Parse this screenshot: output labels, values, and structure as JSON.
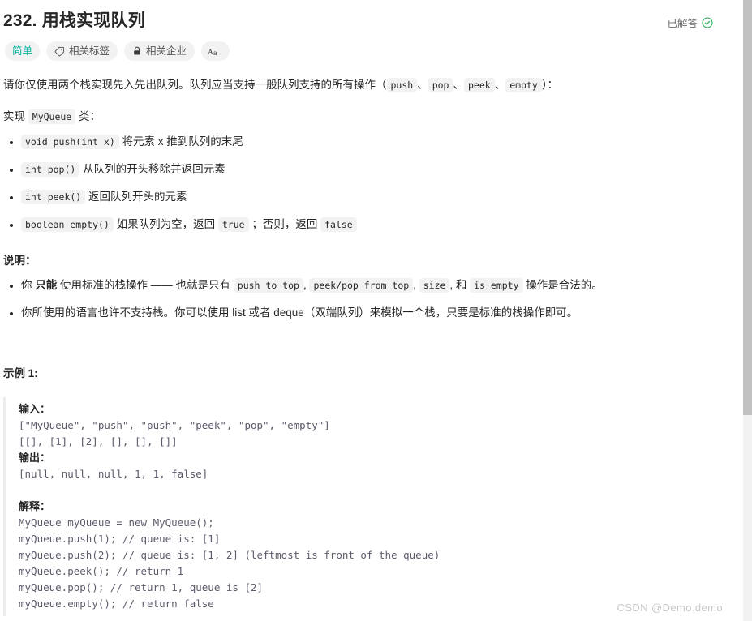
{
  "problem": {
    "title": "232. 用栈实现队列",
    "status_label": "已解答",
    "status_icon": "check-circle-icon",
    "status_color": "#2db55d"
  },
  "tags": {
    "difficulty": {
      "label": "简单",
      "color": "#00af9b"
    },
    "topics": {
      "label": "相关标签",
      "icon": "tag-icon"
    },
    "companies": {
      "label": "相关企业",
      "icon": "lock-icon"
    },
    "font_toggle": {
      "label": "Aa",
      "icon": "font-size-icon"
    }
  },
  "description": {
    "intro_1": "请你仅使用两个栈实现先入先出队列。队列应当支持一般队列支持的所有操作（",
    "intro_code_1": "push",
    "sep_1": "、",
    "intro_code_2": "pop",
    "sep_2": "、",
    "intro_code_3": "peek",
    "sep_3": "、",
    "intro_code_4": "empty",
    "intro_2": "）：",
    "implement_prefix": "实现 ",
    "implement_code": "MyQueue",
    "implement_suffix": " 类：",
    "methods": [
      {
        "code": "void push(int x)",
        "text": " 将元素 x 推到队列的末尾"
      },
      {
        "code": "int pop()",
        "text": " 从队列的开头移除并返回元素"
      },
      {
        "code": "int peek()",
        "text": " 返回队列开头的元素"
      }
    ],
    "method_empty": {
      "code": "boolean empty()",
      "text_1": " 如果队列为空，返回 ",
      "code_true": "true",
      "text_2": " ；否则，返回 ",
      "code_false": "false"
    }
  },
  "notes": {
    "heading": "说明：",
    "item1": {
      "t1": "你 ",
      "bold": "只能",
      "t2": " 使用标准的栈操作 —— 也就是只有 ",
      "c1": "push to top",
      "t3": ", ",
      "c2": "peek/pop from top",
      "t4": ", ",
      "c3": "size",
      "t5": ", 和 ",
      "c4": "is empty",
      "t6": " 操作是合法的。"
    },
    "item2": "你所使用的语言也许不支持栈。你可以使用 list 或者 deque（双端队列）来模拟一个栈，只要是标准的栈操作即可。"
  },
  "example": {
    "heading": "示例 1:",
    "input_label": "输入：",
    "input_lines": "[\"MyQueue\", \"push\", \"push\", \"peek\", \"pop\", \"empty\"]\n[[], [1], [2], [], [], []]",
    "output_label": "输出：",
    "output_lines": "[null, null, null, 1, 1, false]",
    "explain_label": "解释：",
    "explain_lines": "MyQueue myQueue = new MyQueue();\nmyQueue.push(1); // queue is: [1]\nmyQueue.push(2); // queue is: [1, 2] (leftmost is front of the queue)\nmyQueue.peek(); // return 1\nmyQueue.pop(); // return 1, queue is [2]\nmyQueue.empty(); // return false"
  },
  "watermark": {
    "text": "CSDN @Demo.demo"
  }
}
